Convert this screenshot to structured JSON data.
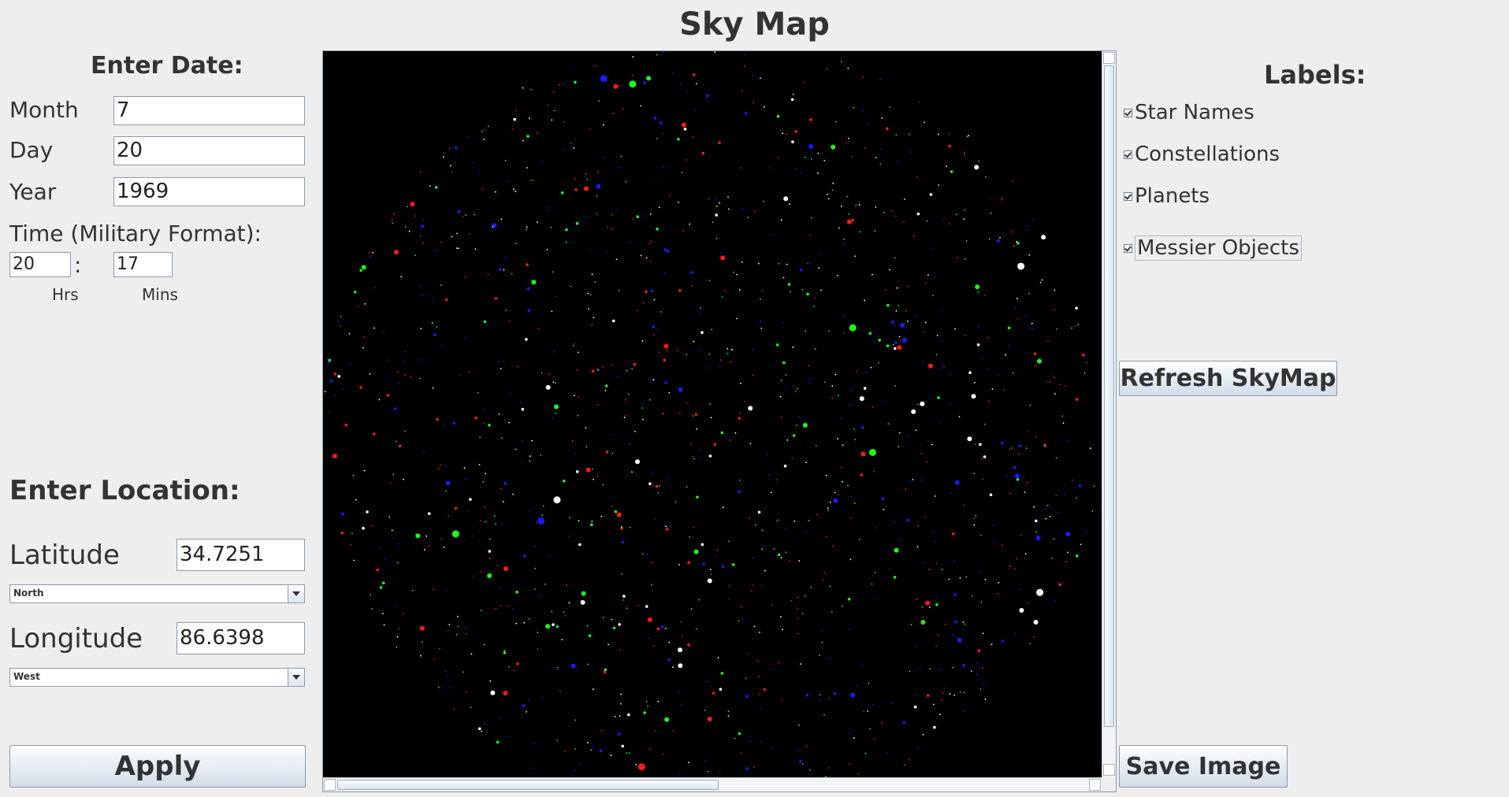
{
  "window": {
    "title": "Sky Map"
  },
  "date_panel": {
    "heading": "Enter Date:",
    "month_label": "Month",
    "month_value": "7",
    "day_label": "Day",
    "day_value": "20",
    "year_label": "Year",
    "year_value": "1969",
    "time_label": "Time (Military Format):",
    "hours_value": "20",
    "separator": ":",
    "minutes_value": "17",
    "hours_caption": "Hrs",
    "minutes_caption": "Mins"
  },
  "location_panel": {
    "heading": "Enter Location:",
    "latitude_label": "Latitude",
    "latitude_value": "34.7251",
    "latitude_dir": "North",
    "longitude_label": "Longitude",
    "longitude_value": "86.6398",
    "longitude_dir": "West"
  },
  "apply_label": "Apply",
  "labels_panel": {
    "heading": "Labels:",
    "options": [
      {
        "label": "Star Names",
        "checked": true
      },
      {
        "label": "Constellations",
        "checked": true
      },
      {
        "label": "Planets",
        "checked": true
      },
      {
        "label": "Messier Objects",
        "checked": true
      }
    ]
  },
  "refresh_label": "Refresh SkyMap",
  "save_label": "Save Image",
  "colors": {
    "sky_background": "#000000",
    "star_white": "#ffffff",
    "star_red": "#ff1a1a",
    "star_green": "#1aff1a",
    "star_blue": "#1a1aff"
  }
}
